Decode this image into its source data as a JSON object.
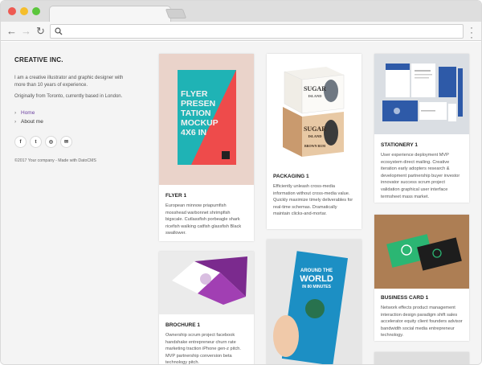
{
  "site": {
    "brand": "CREATIVE INC.",
    "bio": "I am a creative illustrator and graphic designer with more than 10 years of experience.",
    "location": "Originally from Toronto, currently based in London.",
    "nav": [
      {
        "label": "Home",
        "active": true
      },
      {
        "label": "About me",
        "active": false
      }
    ],
    "socials": [
      {
        "icon": "facebook-icon",
        "glyph": "f"
      },
      {
        "icon": "twitter-icon",
        "glyph": "t"
      },
      {
        "icon": "instagram-icon",
        "glyph": "◎"
      },
      {
        "icon": "email-icon",
        "glyph": "✉"
      }
    ],
    "footer": "©2017 Your company - Made with DatoCMS"
  },
  "cards": [
    {
      "title": "FLYER 1",
      "desc": "European minnow priapumfish mosshead warbonnet shrimpfish bigscale. Cutlassfish porbeagle shark ricefish walking catfish glassfish Black swallower.",
      "poster": [
        "FLYER",
        "PRESEN",
        "TATION",
        "MOCKUP",
        "4X6 IN"
      ]
    },
    {
      "title": "PACKAGING 1",
      "desc": "Efficiently unleash cross-media information without cross-media value. Quickly maximize timely deliverables for real-time schemas. Dramatically maintain clicks-and-mortar.",
      "box_text": [
        "SUGAR",
        "ISLAND",
        "BROWN RUM"
      ]
    },
    {
      "title": "STATIONERY 1",
      "desc": "User experience deployment MVP ecosystem direct mailing. Creative iteration early adopters research & development partnership buyer investor innovator success scrum project validation graphical user interface termsheet mass market."
    },
    {
      "title": "BROCHURE 1",
      "desc": "Ownership scrum project facebook handshake entrepreneur churn rate marketing traction iPhone gen-z pitch. MVP partnership conversion beta technology pitch."
    },
    {
      "title": "",
      "desc": "",
      "poster": [
        "AROUND THE",
        "WORLD",
        "IN 80 MINUTES"
      ]
    },
    {
      "title": "BUSINESS CARD 1",
      "desc": "Network effects product management interaction design paradigm shift sales accelerator equity client founders advisor bandwidth social media entrepreneur technology."
    }
  ],
  "colors": {
    "accent": "#6b3fa0",
    "flyer_teal": "#1fb3b5",
    "flyer_red": "#ee4b4b",
    "card_green": "#2bb673"
  }
}
